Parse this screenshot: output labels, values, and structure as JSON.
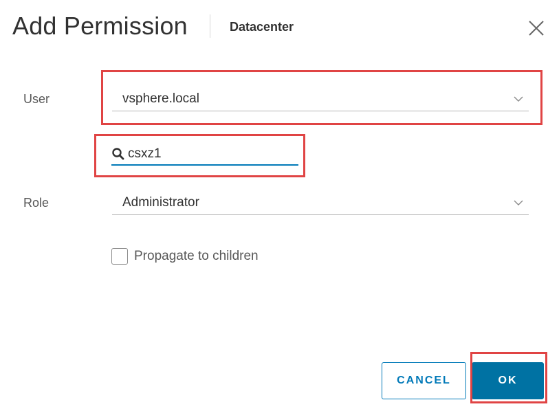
{
  "dialog": {
    "title": "Add Permission",
    "subtitle": "Datacenter",
    "close_icon": "close-icon"
  },
  "form": {
    "user_label": "User",
    "user_domain": "vsphere.local",
    "search_value": "csxz1",
    "search_icon": "search-icon",
    "role_label": "Role",
    "role_value": "Administrator",
    "propagate_label": "Propagate to children",
    "propagate_checked": false
  },
  "buttons": {
    "cancel_label": "CANCEL",
    "ok_label": "OK"
  },
  "colors": {
    "accent": "#0079b8",
    "primary_button": "#0072a3",
    "highlight": "#e04444",
    "text": "#313131"
  }
}
